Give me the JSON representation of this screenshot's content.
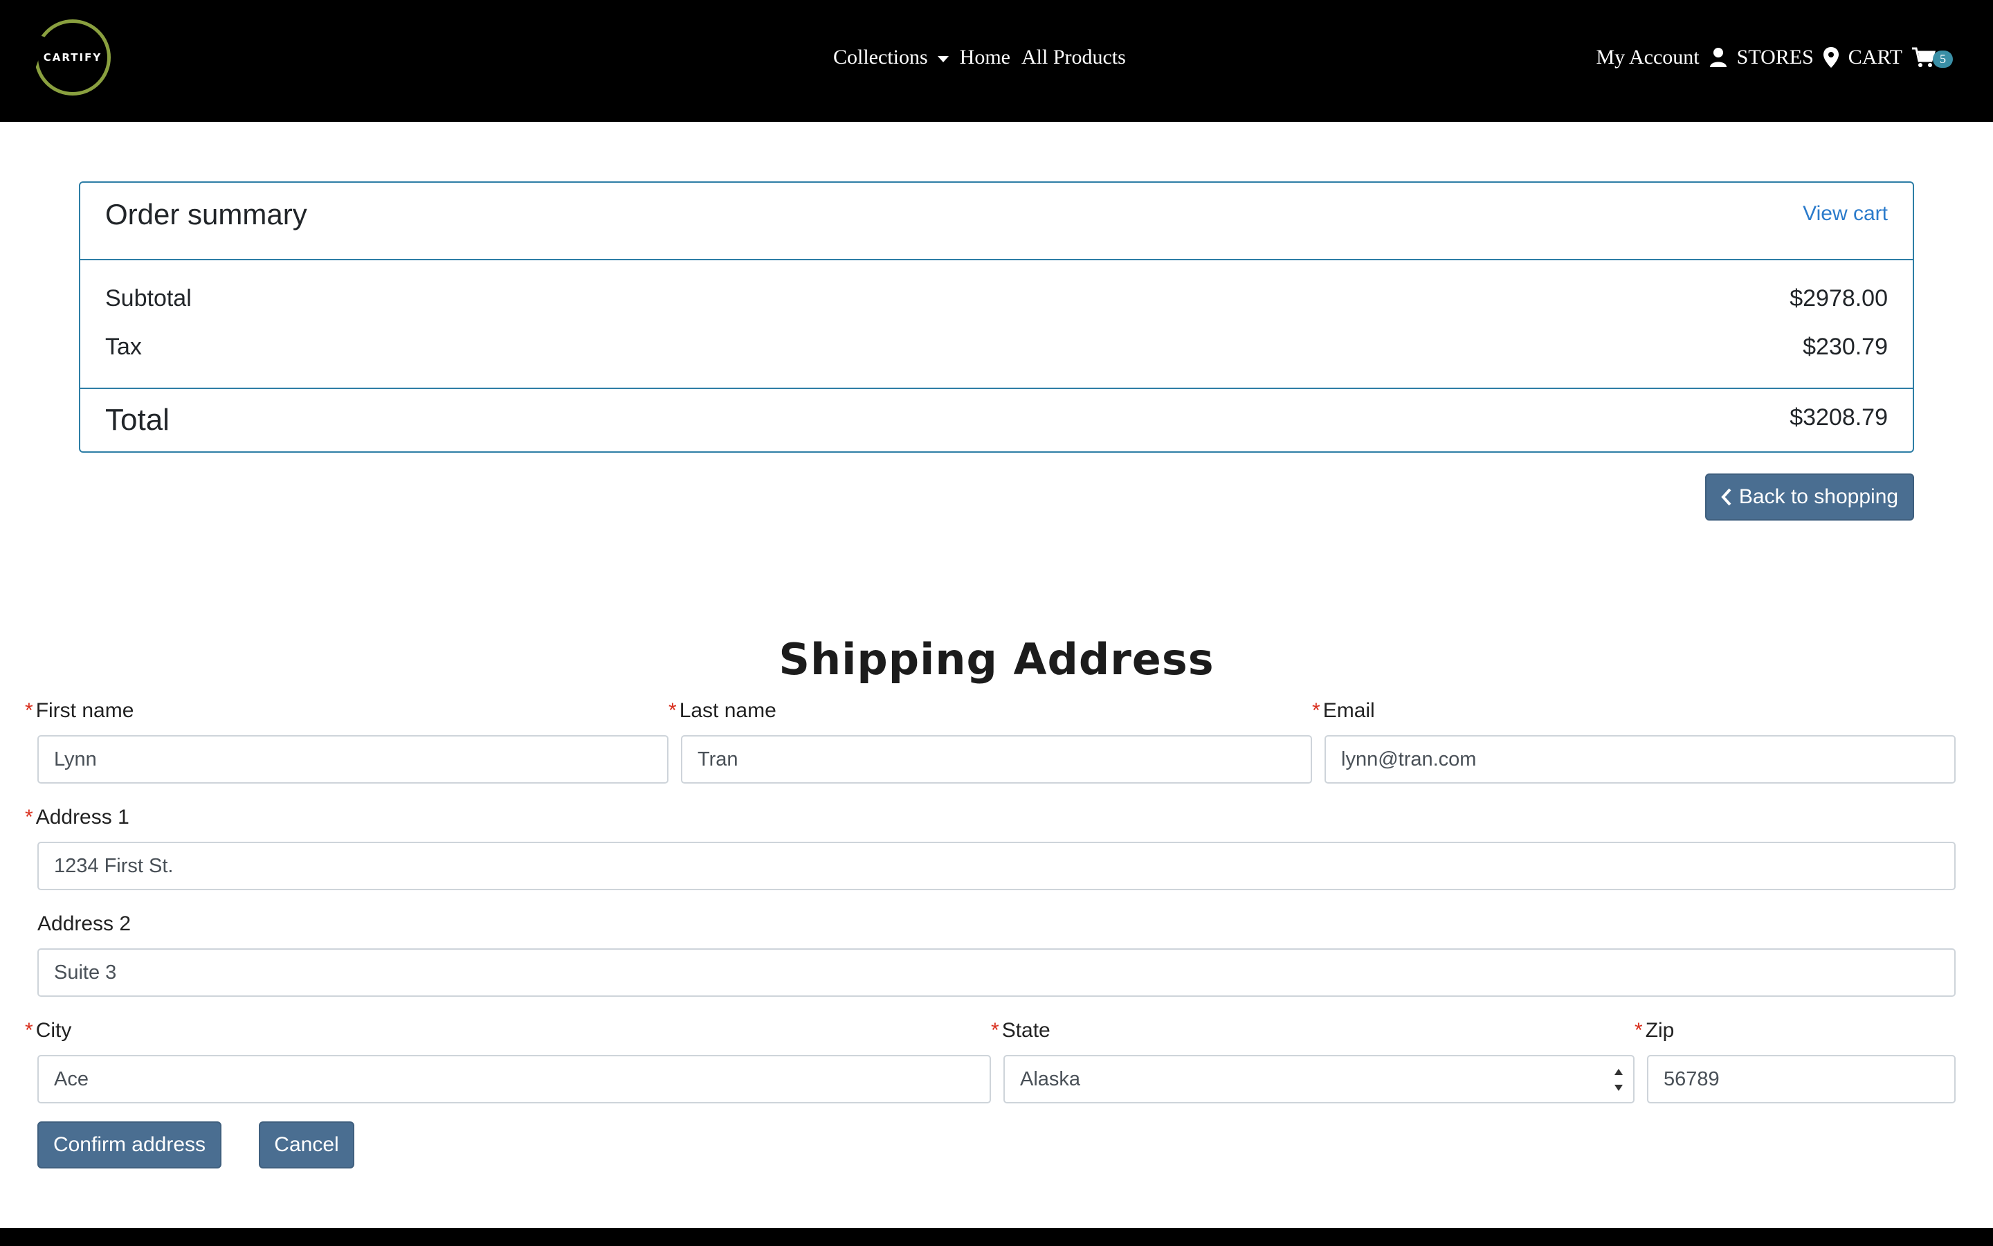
{
  "header": {
    "logo_text": "CARTIFY",
    "nav": {
      "collections": "Collections",
      "home": "Home",
      "all_products": "All Products"
    },
    "right": {
      "my_account": "My Account",
      "stores": "STORES",
      "cart": "CART",
      "cart_count": "5"
    }
  },
  "order_summary": {
    "title": "Order summary",
    "view_cart": "View cart",
    "subtotal_label": "Subtotal",
    "subtotal_value": "$2978.00",
    "tax_label": "Tax",
    "tax_value": "$230.79",
    "total_label": "Total",
    "total_value": "$3208.79"
  },
  "back_button": "Back to shopping",
  "shipping": {
    "title": "Shipping Address",
    "first_name": {
      "label": "First name",
      "value": "Lynn",
      "required": true
    },
    "last_name": {
      "label": "Last name",
      "value": "Tran",
      "required": true
    },
    "email": {
      "label": "Email",
      "value": "lynn@tran.com",
      "required": true
    },
    "address1": {
      "label": "Address 1",
      "value": "1234 First St.",
      "required": true
    },
    "address2": {
      "label": "Address 2",
      "value": "Suite 3",
      "required": false
    },
    "city": {
      "label": "City",
      "value": "Ace",
      "required": true
    },
    "state": {
      "label": "State",
      "value": "Alaska",
      "required": true
    },
    "zip": {
      "label": "Zip",
      "value": "56789",
      "required": true
    },
    "required_mark": "*",
    "confirm_button": "Confirm address",
    "cancel_button": "Cancel"
  },
  "colors": {
    "header_bg": "#000000",
    "logo_ring": "#8aa03f",
    "summary_border": "#2e7ea6",
    "link": "#2b7bcb",
    "button_bg": "#4a6e91",
    "badge_bg": "#3a8fa6",
    "required": "#d9301f"
  },
  "icons": {
    "user": "user-icon",
    "location": "map-pin-icon",
    "cart": "cart-icon",
    "chevron_left": "chevron-left-icon",
    "dropdown": "caret-down-icon"
  }
}
